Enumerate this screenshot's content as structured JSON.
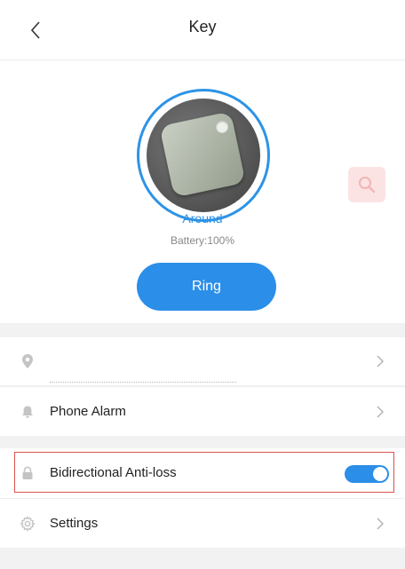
{
  "header": {
    "title": "Key",
    "back_icon": "chevron-left-icon"
  },
  "device": {
    "status": "Around",
    "battery": "Battery:100%",
    "ring_label": "Ring",
    "ring_color": "#2d93e6"
  },
  "list": {
    "location": {
      "icon": "location-pin-icon",
      "label": ""
    },
    "phone_alarm": {
      "icon": "bell-icon",
      "label": "Phone Alarm"
    },
    "anti_loss": {
      "icon": "lock-icon",
      "label": "Bidirectional Anti-loss",
      "enabled": true
    },
    "settings": {
      "icon": "gear-icon",
      "label": "Settings"
    }
  },
  "colors": {
    "accent": "#2b8ee8",
    "highlight": "#d9534f"
  }
}
